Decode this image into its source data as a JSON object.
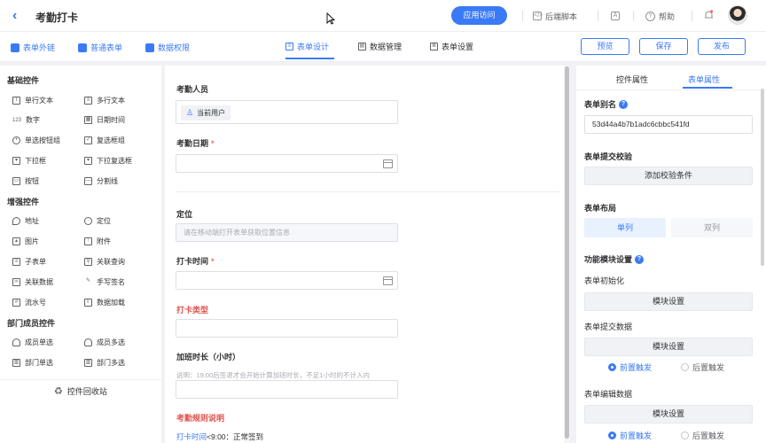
{
  "header": {
    "title": "考勤打卡",
    "visit_label": "应用访问",
    "backend_script": "后端脚本",
    "help": "帮助"
  },
  "toolbar": {
    "links": [
      "表单外链",
      "普通表单",
      "数据权限"
    ],
    "tabs": [
      "表单设计",
      "数据管理",
      "表单设置"
    ],
    "preview": "预览",
    "save": "保存",
    "publish": "发布"
  },
  "left": {
    "basic_title": "基础控件",
    "basic": [
      {
        "label": "单行文本",
        "icon": "text-line-icon"
      },
      {
        "label": "多行文本",
        "icon": "text-multi-icon"
      },
      {
        "label": "数字",
        "icon": "number-icon"
      },
      {
        "label": "日期时间",
        "icon": "calendar-icon"
      },
      {
        "label": "单选按钮组",
        "icon": "radio-icon"
      },
      {
        "label": "复选框组",
        "icon": "checkbox-icon"
      },
      {
        "label": "下拉框",
        "icon": "dropdown-icon"
      },
      {
        "label": "下拉复选框",
        "icon": "dropdown-multi-icon"
      },
      {
        "label": "按钮",
        "icon": "button-icon"
      },
      {
        "label": "分割线",
        "icon": "divider-icon"
      }
    ],
    "advanced_title": "增强控件",
    "advanced": [
      {
        "label": "地址",
        "icon": "location-pin-icon"
      },
      {
        "label": "定位",
        "icon": "target-icon"
      },
      {
        "label": "图片",
        "icon": "image-icon"
      },
      {
        "label": "附件",
        "icon": "upload-icon"
      },
      {
        "label": "子表单",
        "icon": "subform-icon"
      },
      {
        "label": "关联查询",
        "icon": "link-search-icon"
      },
      {
        "label": "关联数据",
        "icon": "link-data-icon"
      },
      {
        "label": "手写签名",
        "icon": "pen-icon"
      },
      {
        "label": "流水号",
        "icon": "serial-icon"
      },
      {
        "label": "数据加载",
        "icon": "data-load-icon"
      }
    ],
    "dept_title": "部门成员控件",
    "dept": [
      {
        "label": "成员单选",
        "icon": "user-icon"
      },
      {
        "label": "成员多选",
        "icon": "users-icon"
      },
      {
        "label": "部门单选",
        "icon": "dept-icon"
      },
      {
        "label": "部门多选",
        "icon": "dept-multi-icon"
      }
    ],
    "recycle": "控件回收站"
  },
  "form": {
    "f1_label": "考勤人员",
    "f1_chip": "当前用户",
    "f2_label": "考勤日期",
    "f3_label": "定位",
    "f3_placeholder": "请在移动端打开表单获取位置信息",
    "f4_label": "打卡时间",
    "f5_label": "打卡类型",
    "f6_label": "加班时长（小时）",
    "f6_hint": "说明：19:00后签退才会开始计算加班时长，不足1小时的不计入内",
    "f7_label": "考勤规则说明",
    "rule_blue": "打卡时间",
    "rule_rest": "<9:00：正常签到",
    "required_mark": "*"
  },
  "right": {
    "tabs": [
      "控件属性",
      "表单属性"
    ],
    "alias_title": "表单别名",
    "alias_value": "53d44a4b7b1adc6cbbc541fd",
    "validate_title": "表单提交校验",
    "validate_btn": "添加校验条件",
    "layout_title": "表单布局",
    "layout_single": "单列",
    "layout_double": "双列",
    "module_title": "功能模块设置",
    "init_title": "表单初始化",
    "module_btn": "模块设置",
    "submit_title": "表单提交数据",
    "before": "前置触发",
    "after": "后置触发",
    "edit_title": "表单编辑数据"
  },
  "colors": {
    "accent": "#3a7af6",
    "required": "#f56c6c",
    "label_red": "#e0524e"
  }
}
